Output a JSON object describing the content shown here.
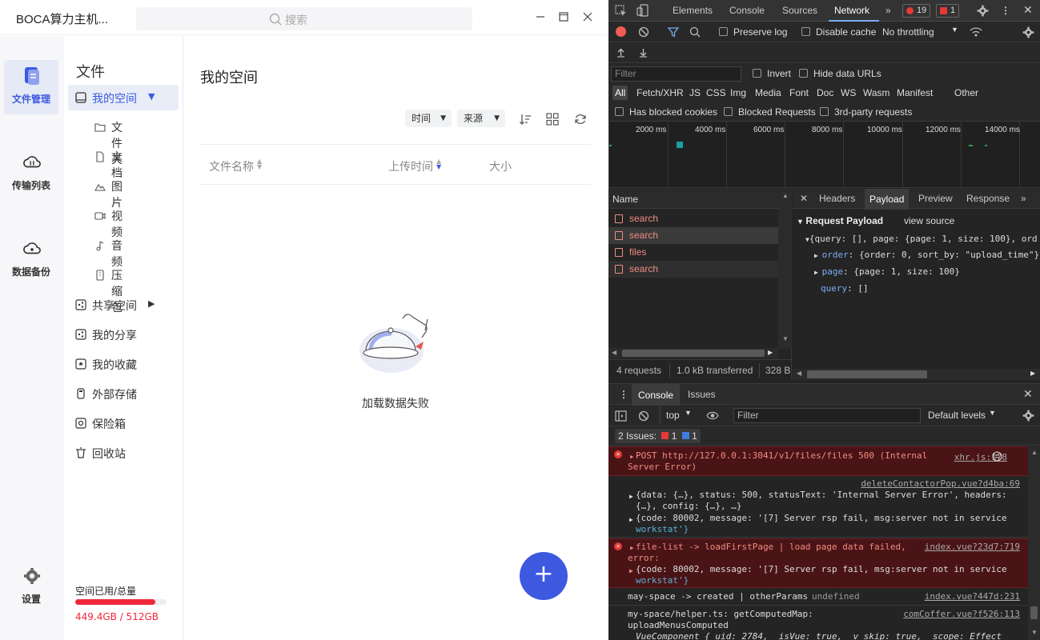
{
  "app": {
    "title": "BOCA算力主机...",
    "search_placeholder": "搜索",
    "window_controls": [
      "minimize",
      "maximize",
      "close"
    ]
  },
  "rail": {
    "items": [
      {
        "label": "文件管理",
        "icon": "file-manager-icon",
        "active": true
      },
      {
        "label": "传输列表",
        "icon": "cloud-transfer-icon",
        "active": false
      },
      {
        "label": "数据备份",
        "icon": "cloud-backup-icon",
        "active": false
      },
      {
        "label": "设置",
        "icon": "gear-icon",
        "active": false
      }
    ]
  },
  "nav": {
    "heading": "文件",
    "my_space": "我的空间",
    "sub_items": [
      "文件夹",
      "文档",
      "图片",
      "视频",
      "音频",
      "压缩包"
    ],
    "items": [
      "共享空间",
      "我的分享",
      "我的收藏",
      "外部存储",
      "保险箱",
      "回收站"
    ],
    "storage_label": "空间已用/总量",
    "storage_value": "449.4GB / 512GB",
    "storage_fraction": 0.878
  },
  "main": {
    "title": "我的空间",
    "filter_time": "时间",
    "filter_source": "来源",
    "columns": [
      "文件名称",
      "上传时间",
      "大小"
    ],
    "empty_message": "加载数据失败",
    "fab": "+"
  },
  "devtools": {
    "tabs": [
      "Elements",
      "Console",
      "Sources",
      "Network"
    ],
    "error_count": "19",
    "issue_count": "1",
    "preserve_log": "Preserve log",
    "disable_cache": "Disable cache",
    "throttling": "No throttling",
    "filter_placeholder": "Filter",
    "invert": "Invert",
    "hide_data_urls": "Hide data URLs",
    "types": [
      "All",
      "Fetch/XHR",
      "JS",
      "CSS",
      "Img",
      "Media",
      "Font",
      "Doc",
      "WS",
      "Wasm",
      "Manifest",
      "Other"
    ],
    "blocked_cookies": "Has blocked cookies",
    "blocked_requests": "Blocked Requests",
    "third_party": "3rd-party requests",
    "timeline_ticks": [
      "2000 ms",
      "4000 ms",
      "6000 ms",
      "8000 ms",
      "10000 ms",
      "12000 ms",
      "14000 ms"
    ],
    "name_header": "Name",
    "requests": [
      "search",
      "search",
      "files",
      "search"
    ],
    "status_requests": "4 requests",
    "status_transferred": "1.0 kB transferred",
    "status_size": "328 B",
    "detail_tabs": [
      "Headers",
      "Payload",
      "Preview",
      "Response"
    ],
    "payload_title": "Request Payload",
    "view_source": "view source",
    "payload_summary": "{query: [], page: {page: 1, size: 100}, ord",
    "payload_order_key": "order",
    "payload_order_val": ": {order: 0, sort_by: \"upload_time\"}",
    "payload_page_key": "page",
    "payload_page_val": ": {page: 1, size: 100}",
    "payload_query_key": "query",
    "payload_query_val": ": []",
    "console_tabs": [
      "Console",
      "Issues"
    ],
    "context": "top",
    "console_filter": "Filter",
    "levels": "Default levels",
    "issues_label": "2 Issues:",
    "issues_err": "1",
    "issues_info": "1",
    "messages": {
      "m1_text": "POST http://127.0.0.1:3041/v1/files/files 500 (Internal",
      "m1_text2": "Server Error)",
      "m1_src": "xhr.js:178",
      "m2_src": "deleteContactorPop.vue?d4ba:69",
      "m2_line1": "{data: {…}, status: 500, statusText: 'Internal Server Error', headers:",
      "m2_line2": "{…}, config: {…}, …}",
      "m2_line3": "{code: 80002, message: '[7] Server rsp fail, msg:server not in service",
      "m2_line4": "workstat'}",
      "m3_text": "file-list -> loadFirstPage | load page data failed,",
      "m3_text2": "error:",
      "m3_src": "index.vue?23d7:719",
      "m3_line3": "{code: 80002, message: '[7] Server rsp fail, msg:server not in service",
      "m3_line4": "workstat'}",
      "m4_text": "may-space -> created | otherParams",
      "m4_undef": "undefined",
      "m4_src": "index.vue?447d:231",
      "m5_text": "my-space/helper.ts: getComputedMap:",
      "m5_text2": "uploadMenusComputed",
      "m5_src": "comCoffer.vue?f526:113",
      "m5_line3": "VueComponent {_uid: 2784, _isVue: true, _v_skip: true, _scope: Effect"
    }
  },
  "colors": {
    "accent": "#3d59e0",
    "danger": "#f0273a",
    "devtools_bg": "#242424"
  }
}
